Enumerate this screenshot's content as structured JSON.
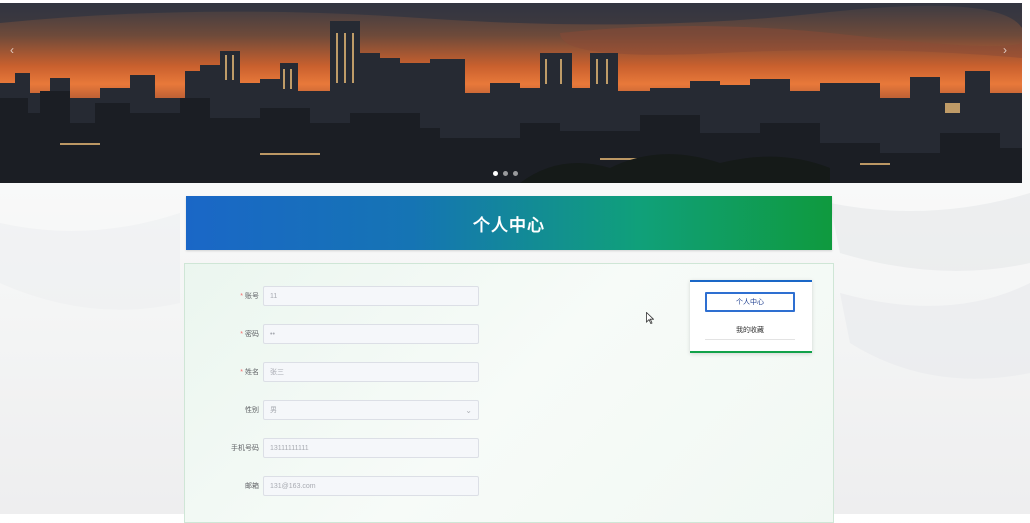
{
  "banner": {
    "prev_arrow": "‹",
    "next_arrow": "›",
    "slides": 3,
    "active_slide": 1
  },
  "header": {
    "title": "个人中心"
  },
  "form": {
    "fields": [
      {
        "label": "账号",
        "required": true,
        "value": "11"
      },
      {
        "label": "密码",
        "required": true,
        "value": "••"
      },
      {
        "label": "姓名",
        "required": true,
        "value": "张三"
      },
      {
        "label": "性别",
        "required": false,
        "value": "男"
      },
      {
        "label": "手机号码",
        "required": false,
        "value": "13111111111"
      },
      {
        "label": "邮箱",
        "required": false,
        "value": "131@163.com"
      }
    ]
  },
  "side_menu": {
    "active_item": "个人中心",
    "item_2": "我的收藏"
  },
  "colors": {
    "header_start": "#1a67c7",
    "header_end": "#0f9a3e",
    "required": "#f56c6c"
  }
}
